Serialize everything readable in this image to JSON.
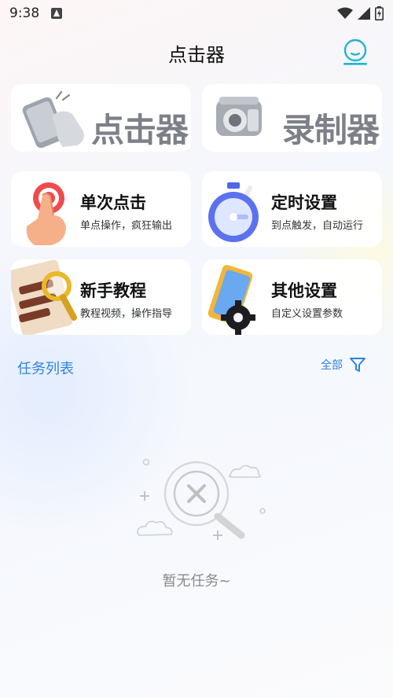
{
  "status_bar": {
    "time": "9:38",
    "icons": [
      "app-notification-icon",
      "wifi-icon",
      "signal-icon",
      "battery-charging-icon"
    ]
  },
  "header": {
    "title": "点击器",
    "profile_icon": "user-profile-icon"
  },
  "banners": [
    {
      "text": "点击器",
      "icon": "phone-tap-icon"
    },
    {
      "text": "录制器",
      "icon": "camera-icon"
    }
  ],
  "features": [
    {
      "title": "单次点击",
      "subtitle": "单点操作，疯狂输出",
      "icon": "tap-finger-icon"
    },
    {
      "title": "定时设置",
      "subtitle": "到点触发，自动运行",
      "icon": "stopwatch-icon"
    },
    {
      "title": "新手教程",
      "subtitle": "教程视频，操作指导",
      "icon": "magnifier-book-icon"
    },
    {
      "title": "其他设置",
      "subtitle": "自定义设置参数",
      "icon": "settings-gear-icon"
    }
  ],
  "task_list": {
    "title": "任务列表",
    "filter_label": "全部",
    "filter_icon": "filter-icon",
    "empty_text": "暂无任务~",
    "empty_icon": "no-results-search-icon"
  },
  "colors": {
    "accent": "#2d84e0",
    "profile": "#1fb3d8"
  }
}
